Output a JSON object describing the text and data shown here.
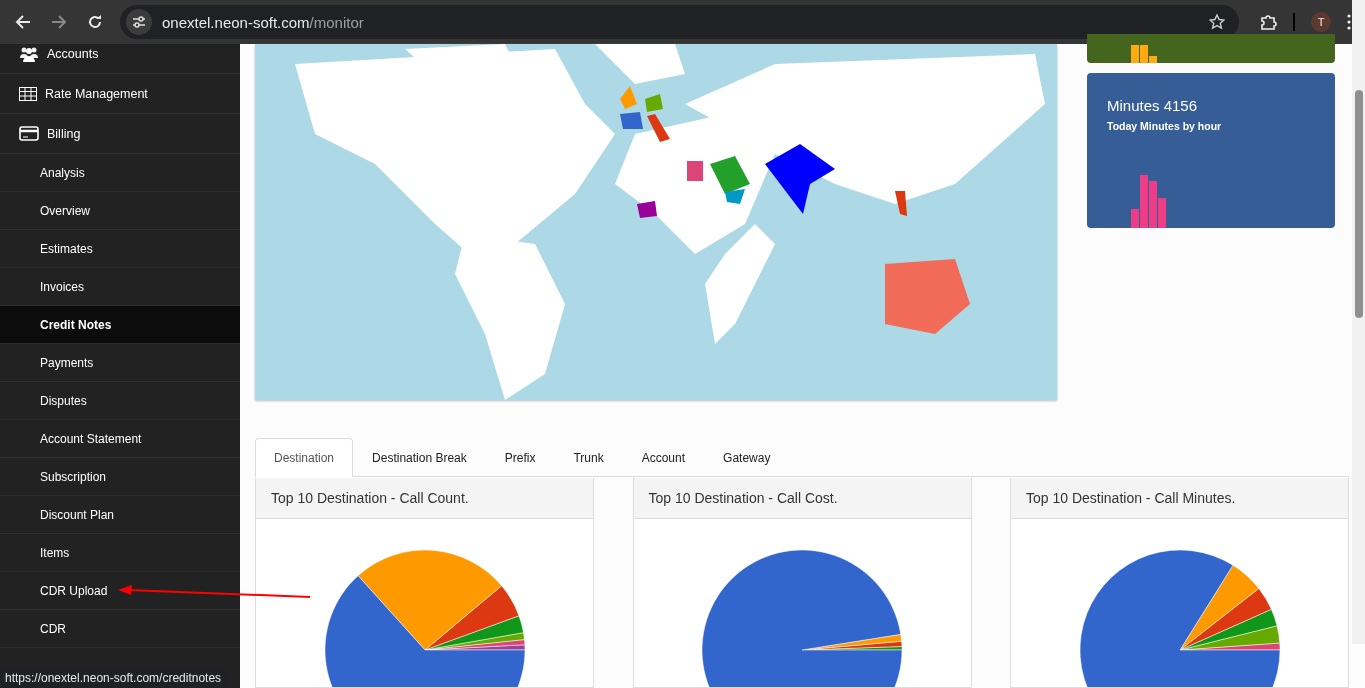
{
  "browser": {
    "url_host": "onextel.neon-soft.com",
    "url_path": "/monitor",
    "profile_initial": "T"
  },
  "sidebar": {
    "items": [
      {
        "label": "Accounts",
        "kind": "section",
        "selected": false
      },
      {
        "label": "Rate Management",
        "kind": "section",
        "selected": false
      },
      {
        "label": "Billing",
        "kind": "section",
        "selected": false
      },
      {
        "label": "Analysis",
        "kind": "sub",
        "selected": false
      },
      {
        "label": "Overview",
        "kind": "sub",
        "selected": false
      },
      {
        "label": "Estimates",
        "kind": "sub",
        "selected": false
      },
      {
        "label": "Invoices",
        "kind": "sub",
        "selected": false
      },
      {
        "label": "Credit Notes",
        "kind": "sub",
        "selected": true
      },
      {
        "label": "Payments",
        "kind": "sub",
        "selected": false
      },
      {
        "label": "Disputes",
        "kind": "sub",
        "selected": false
      },
      {
        "label": "Account Statement",
        "kind": "sub",
        "selected": false
      },
      {
        "label": "Subscription",
        "kind": "sub",
        "selected": false
      },
      {
        "label": "Discount Plan",
        "kind": "sub",
        "selected": false
      },
      {
        "label": "Items",
        "kind": "sub",
        "selected": false
      },
      {
        "label": "CDR Upload",
        "kind": "sub",
        "selected": false
      },
      {
        "label": "CDR",
        "kind": "sub",
        "selected": false
      }
    ]
  },
  "stat_cards": [
    {
      "title": "Minutes 4156",
      "subtitle": "Today Minutes by hour"
    }
  ],
  "tabs": [
    {
      "label": "Destination",
      "selected": true
    },
    {
      "label": "Destination Break",
      "selected": false
    },
    {
      "label": "Prefix",
      "selected": false
    },
    {
      "label": "Trunk",
      "selected": false
    },
    {
      "label": "Account",
      "selected": false
    },
    {
      "label": "Gateway",
      "selected": false
    }
  ],
  "panels": [
    {
      "title": "Top 10 Destination - Call Count."
    },
    {
      "title": "Top 10 Destination - Call Cost."
    },
    {
      "title": "Top 10 Destination - Call Minutes."
    }
  ],
  "status_link": "https://onextel.neon-soft.com/creditnotes"
}
